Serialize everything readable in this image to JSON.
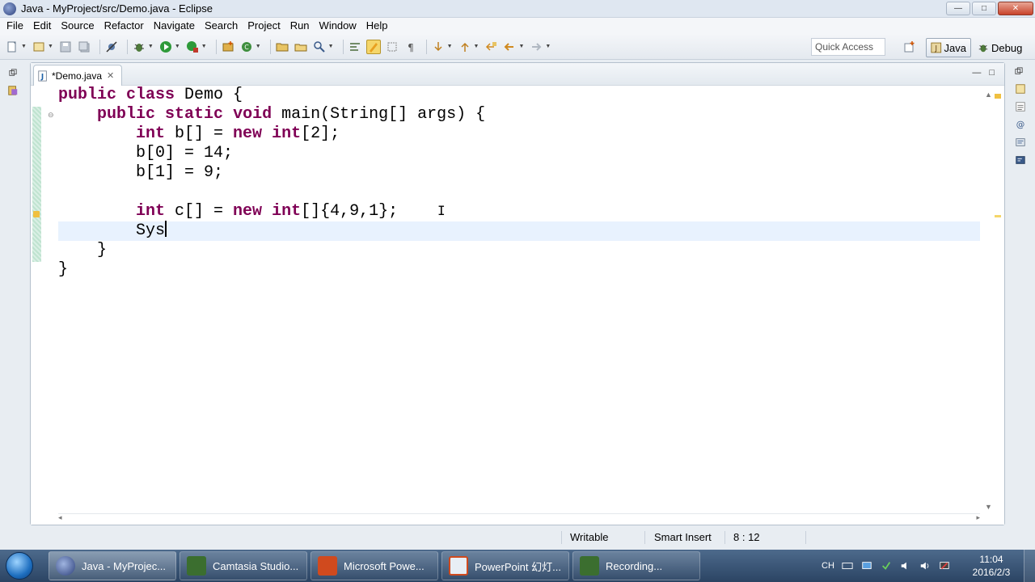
{
  "window": {
    "title": "Java - MyProject/src/Demo.java - Eclipse",
    "controls": {
      "minimize": "—",
      "maximize": "□",
      "close": "✕"
    }
  },
  "menu": [
    "File",
    "Edit",
    "Source",
    "Refactor",
    "Navigate",
    "Search",
    "Project",
    "Run",
    "Window",
    "Help"
  ],
  "toolbar": {
    "quick_access_label": "Quick Access",
    "perspectives": [
      {
        "label": "Java",
        "icon": "java-perspective-icon",
        "active": true
      },
      {
        "label": "Debug",
        "icon": "debug-perspective-icon",
        "active": false
      }
    ]
  },
  "editor": {
    "tab_label": "*Demo.java",
    "close_glyph": "✕",
    "view_minimize": "—",
    "view_maximize": "□",
    "current_line_index": 7,
    "lines": [
      [
        {
          "t": "public",
          "k": 1
        },
        {
          "t": " "
        },
        {
          "t": "class",
          "k": 1
        },
        {
          "t": " Demo {"
        }
      ],
      [
        {
          "t": "    "
        },
        {
          "t": "public",
          "k": 1
        },
        {
          "t": " "
        },
        {
          "t": "static",
          "k": 1
        },
        {
          "t": " "
        },
        {
          "t": "void",
          "k": 1
        },
        {
          "t": " main(String[] args) {"
        }
      ],
      [
        {
          "t": "        "
        },
        {
          "t": "int",
          "k": 1
        },
        {
          "t": " b[] = "
        },
        {
          "t": "new",
          "k": 1
        },
        {
          "t": " "
        },
        {
          "t": "int",
          "k": 1
        },
        {
          "t": "[2];"
        }
      ],
      [
        {
          "t": "        b[0] = 14;"
        }
      ],
      [
        {
          "t": "        b[1] = 9;"
        }
      ],
      [
        {
          "t": ""
        }
      ],
      [
        {
          "t": "        "
        },
        {
          "t": "int",
          "k": 1
        },
        {
          "t": " c[] = "
        },
        {
          "t": "new",
          "k": 1
        },
        {
          "t": " "
        },
        {
          "t": "int",
          "k": 1
        },
        {
          "t": "[]{4,9,1};"
        }
      ],
      [
        {
          "t": "        Sys"
        }
      ],
      [
        {
          "t": "    }"
        }
      ],
      [
        {
          "t": "}"
        }
      ]
    ]
  },
  "status": {
    "writable": "Writable",
    "insert_mode": "Smart Insert",
    "position": "8 : 12"
  },
  "taskbar": {
    "tasks": [
      {
        "label": "Java - MyProjec...",
        "icon": "eclipse-icon",
        "color": "#2c3f7a",
        "active": true
      },
      {
        "label": "Camtasia Studio...",
        "icon": "camtasia-icon",
        "color": "#3b6e2f",
        "active": false
      },
      {
        "label": "Microsoft Powe...",
        "icon": "powerpoint-icon",
        "color": "#d04a1e",
        "active": false
      },
      {
        "label": "PowerPoint 幻灯...",
        "icon": "powerpoint-slideshow-icon",
        "color": "#d04a1e",
        "active": false
      },
      {
        "label": "Recording...",
        "icon": "recording-icon",
        "color": "#3b6e2f",
        "active": false
      }
    ],
    "tray_lang": "CH",
    "time": "11:04",
    "date": "2016/2/3"
  }
}
